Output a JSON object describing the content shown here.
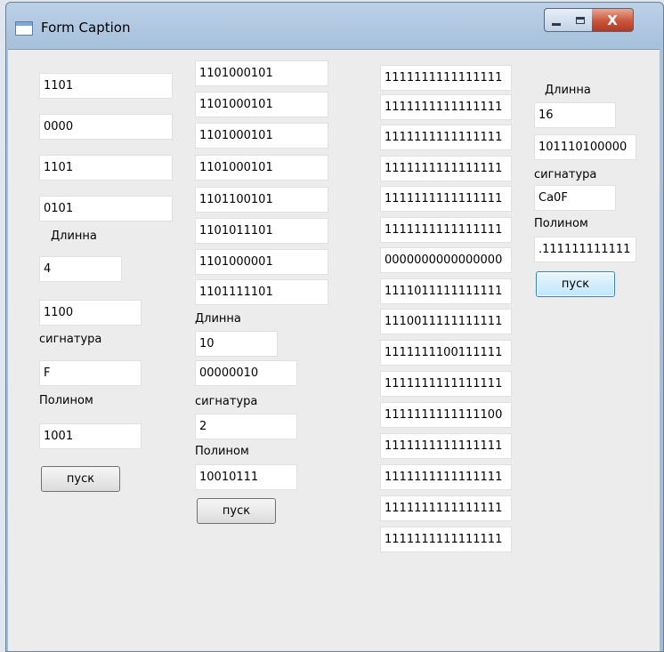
{
  "window": {
    "title": "Form Caption",
    "close_glyph": "X"
  },
  "panel1": {
    "fields": [
      "1101",
      "0000",
      "1101",
      "0101"
    ],
    "length_label": "Длинна",
    "length_value": "4",
    "result_value": "1100",
    "signature_label": "сигнатура",
    "signature_value": "F",
    "poly_label": "Полином",
    "poly_value": "1001",
    "run_label": "пуск"
  },
  "panel2": {
    "fields": [
      "1101000101",
      "1101000101",
      "1101000101",
      "1101000101",
      "1101100101",
      "1101011101",
      "1101000001",
      "1101111101"
    ],
    "length_label": "Длинна",
    "length_value": "10",
    "result_value": "00000010",
    "signature_label": "сигнатура",
    "signature_value": "2",
    "poly_label": "Полином",
    "poly_value": "10010111",
    "run_label": "пуск"
  },
  "panel3": {
    "fields": [
      "1111111111111111",
      "1111111111111111",
      "1111111111111111",
      "1111111111111111",
      "1111111111111111",
      "1111111111111111",
      "0000000000000000",
      "1111011111111111",
      "1110011111111111",
      "1111111100111111",
      "1111111111111111",
      "1111111111111100",
      "1111111111111111",
      "1111111111111111",
      "1111111111111111",
      "1111111111111111"
    ]
  },
  "panel4": {
    "length_label": "Длинна",
    "length_value": "16",
    "result_value": "101110100000",
    "signature_label": "сигнатура",
    "signature_value": "Ca0F",
    "poly_label": "Полином",
    "poly_value": ".111111111111",
    "run_label": "пуск"
  }
}
